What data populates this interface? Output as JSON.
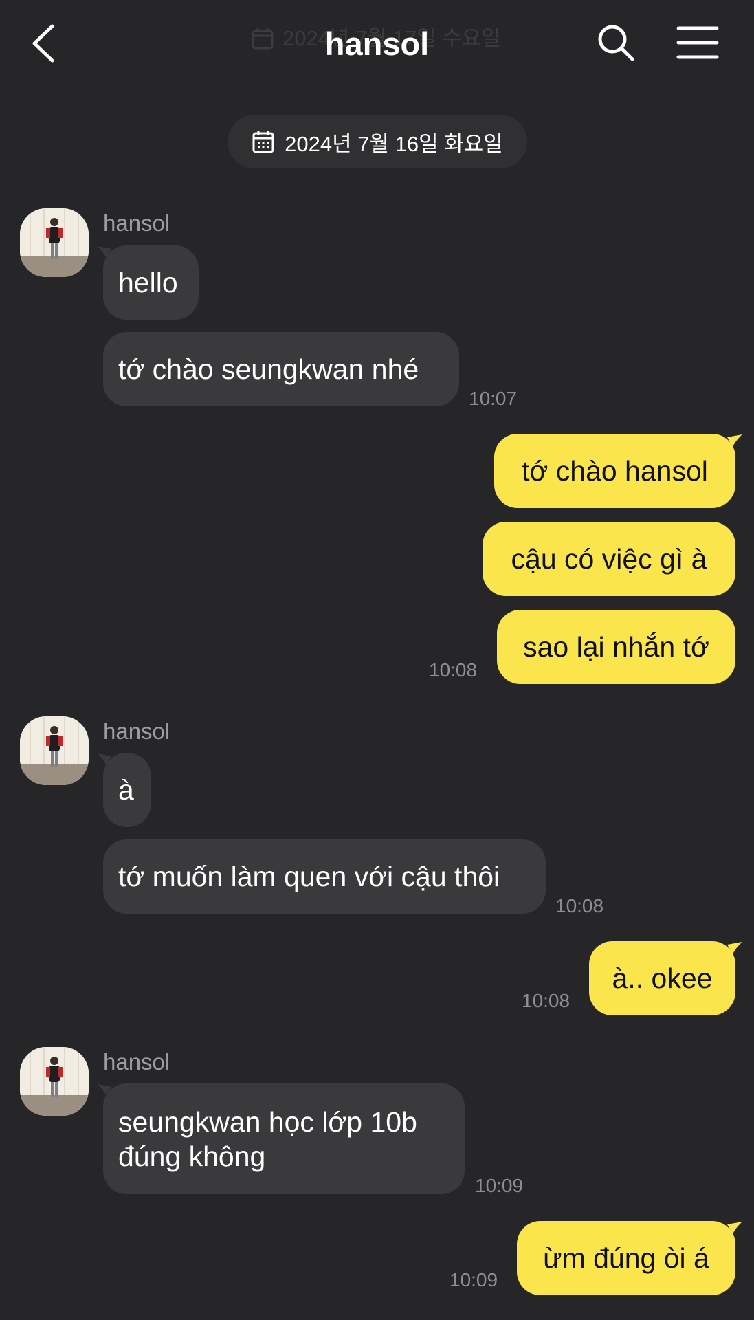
{
  "header": {
    "title": "hansol",
    "faded_date": "2024년 7월 17일 수요일"
  },
  "date_divider": "2024년 7월 16일 화요일",
  "colors": {
    "background": "#262628",
    "incoming_bubble": "#3a3a3c",
    "outgoing_bubble": "#fbe54d"
  },
  "messages": [
    {
      "direction": "in",
      "sender": "hansol",
      "text": "hello"
    },
    {
      "direction": "in",
      "text": "tớ chào seungkwan nhé",
      "time": "10:07"
    },
    {
      "direction": "out",
      "text": "tớ chào hansol"
    },
    {
      "direction": "out",
      "text": "cậu có việc gì à"
    },
    {
      "direction": "out",
      "text": "sao lại nhắn tớ",
      "time": "10:08"
    },
    {
      "direction": "in",
      "sender": "hansol",
      "text": "à"
    },
    {
      "direction": "in",
      "text": "tớ muốn làm quen với cậu thôi",
      "time": "10:08"
    },
    {
      "direction": "out",
      "text": "à.. okee",
      "time": "10:08"
    },
    {
      "direction": "in",
      "sender": "hansol",
      "lines": [
        "seungkwan học lớp 10b",
        "đúng không"
      ],
      "time": "10:09"
    },
    {
      "direction": "out",
      "text": "ừm đúng òi á",
      "time": "10:09"
    }
  ]
}
